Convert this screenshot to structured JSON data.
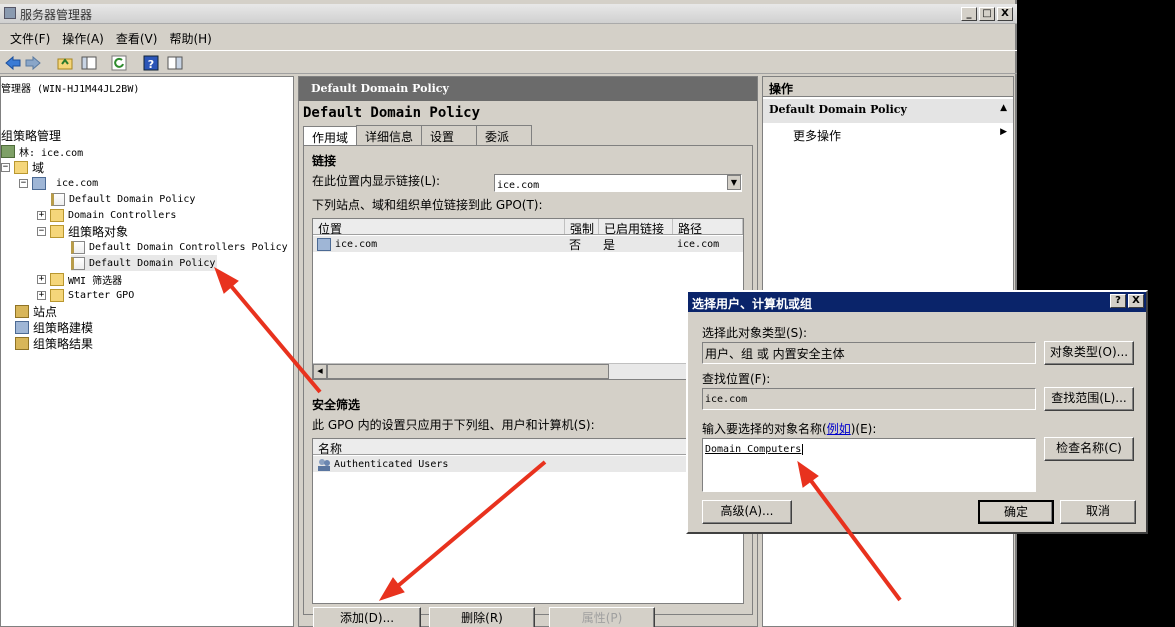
{
  "window": {
    "title": "服务器管理器"
  },
  "caption_buttons": [
    "_",
    "□",
    "X"
  ],
  "menu": [
    "文件(F)",
    "操作(A)",
    "查看(V)",
    "帮助(H)"
  ],
  "tree": {
    "root": "管理器 (WIN-HJ1M44JL2BW)",
    "gpm": "组策略管理",
    "forest": "林: ice.com",
    "domains": "域",
    "domain": "ice.com",
    "ddp_link": "Default Domain Policy",
    "dc_ou": "Domain Controllers",
    "gpo_container": "组策略对象",
    "ddcp": "Default Domain Controllers Policy",
    "ddp": "Default Domain Policy",
    "wmi": "WMI 筛选器",
    "starter": "Starter GPO",
    "sites": "站点",
    "modeling": "组策略建模",
    "results": "组策略结果"
  },
  "middle": {
    "header": "Default Domain Policy",
    "title": "Default Domain Policy",
    "tabs": [
      "作用域",
      "详细信息",
      "设置",
      "委派"
    ],
    "links_heading": "链接",
    "display_links_label": "在此位置内显示链接(L):",
    "display_links_value": "ice.com",
    "linked_label": "下列站点、域和组织单位链接到此 GPO(T):",
    "links_columns": [
      "位置",
      "强制",
      "已启用链接",
      "路径"
    ],
    "links_rows": [
      {
        "location": "ice.com",
        "enforced": "否",
        "enabled": "是",
        "path": "ice.com"
      }
    ],
    "security_heading": "安全筛选",
    "security_label": "此 GPO 内的设置只应用于下列组、用户和计算机(S):",
    "security_column": "名称",
    "security_rows": [
      "Authenticated Users"
    ],
    "buttons": {
      "add": "添加(D)...",
      "remove": "删除(R)",
      "properties": "属性(P)"
    }
  },
  "right": {
    "header": "操作",
    "section": "Default Domain Policy",
    "more_actions": "更多操作"
  },
  "dialog": {
    "title": "选择用户、计算机或组",
    "help_btn": "?",
    "close_btn": "X",
    "object_type_label": "选择此对象类型(S):",
    "object_type_value": "用户、组 或 内置安全主体",
    "object_type_btn": "对象类型(O)...",
    "location_label": "查找位置(F):",
    "location_value": "ice.com",
    "location_btn": "查找范围(L)...",
    "names_label_pre": "输入要选择的对象名称(",
    "names_label_link": "例如",
    "names_label_post": ")(E):",
    "names_value": "Domain Computers",
    "check_btn": "检查名称(C)",
    "advanced_btn": "高级(A)...",
    "ok_btn": "确定",
    "cancel_btn": "取消"
  },
  "colors": {
    "arrow": "#e8321e",
    "dialog_title": "#0a246a",
    "pane_header": "#6b6b6b"
  }
}
